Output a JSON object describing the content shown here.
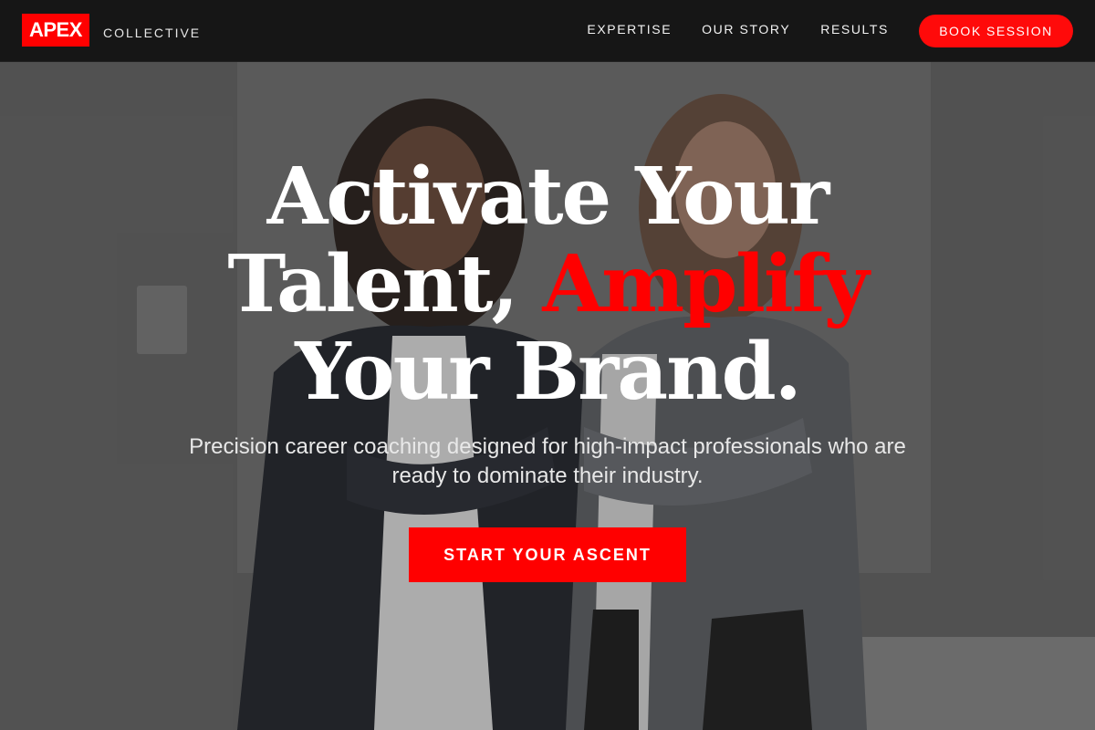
{
  "brand": {
    "logo_text": "APEX",
    "logo_sub": "COLLECTIVE"
  },
  "nav": {
    "links": [
      {
        "label": "EXPERTISE"
      },
      {
        "label": "OUR STORY"
      },
      {
        "label": "RESULTS"
      }
    ],
    "cta_label": "BOOK SESSION"
  },
  "hero": {
    "headline_line1": "Activate Your",
    "headline_line2_a": "Talent,",
    "headline_line2_accent": "Amplify",
    "headline_line3": "Your Brand.",
    "subhead": "Precision career coaching designed for high-impact professionals who are ready to dominate their industry.",
    "cta_label": "START YOUR ASCENT"
  },
  "colors": {
    "accent": "#ff0000",
    "navbar_bg": "#161616",
    "text_primary": "#ffffff"
  }
}
